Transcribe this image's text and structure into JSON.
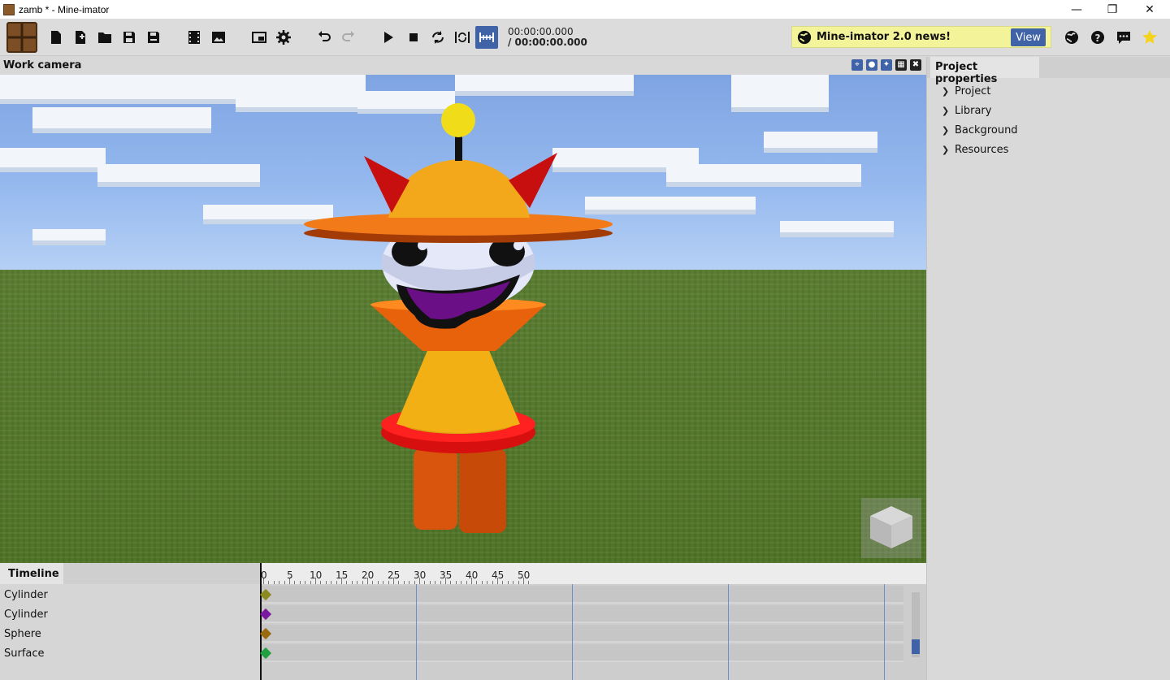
{
  "window": {
    "title": "zamb * - Mine-imator"
  },
  "toolbar": {
    "time_current": "00:00:00.000",
    "time_total": "/ 00:00:00.000",
    "news_label": "Mine-imator 2.0 news!",
    "news_button": "View"
  },
  "viewport": {
    "title": "Work camera"
  },
  "panel": {
    "tab": "Project properties",
    "items": [
      {
        "label": "Project"
      },
      {
        "label": "Library"
      },
      {
        "label": "Background"
      },
      {
        "label": "Resources"
      }
    ]
  },
  "timeline": {
    "tab": "Timeline",
    "ruler": [
      "0",
      "5",
      "10",
      "15",
      "20",
      "25",
      "30",
      "35",
      "40",
      "45",
      "50"
    ],
    "rows": [
      {
        "label": "Cylinder",
        "kf_color": "#8a8a20"
      },
      {
        "label": "Cylinder",
        "kf_color": "#7a1aa0"
      },
      {
        "label": "Sphere",
        "kf_color": "#9a6a10"
      },
      {
        "label": "Surface",
        "kf_color": "#22a040"
      }
    ]
  },
  "colors": {
    "accent": "#3f63a6",
    "news_bg": "#f3f39a"
  }
}
